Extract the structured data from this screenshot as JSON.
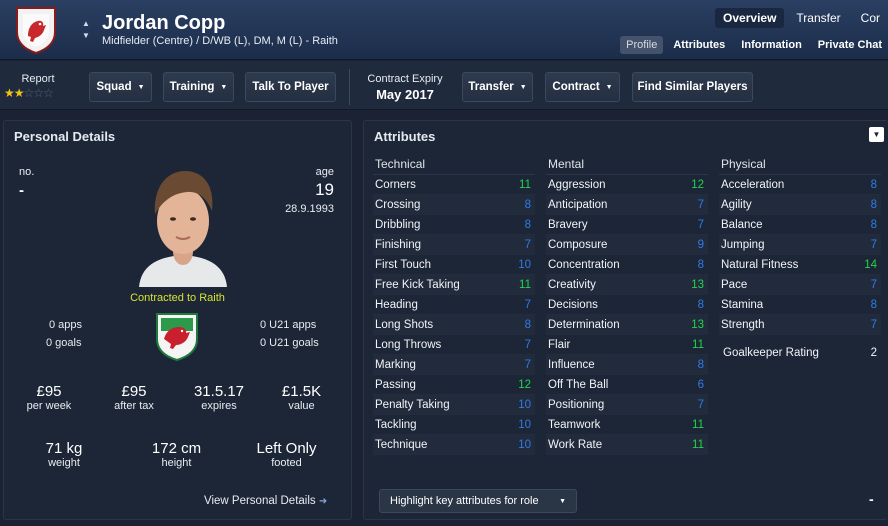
{
  "header": {
    "name": "Jordan Copp",
    "positions": "Midfielder (Centre) / D/WB (L), DM, M (L) - Raith",
    "tabs": [
      "Overview",
      "Transfer",
      "Cor"
    ],
    "subtabs": [
      "Profile",
      "Attributes",
      "Information",
      "Private Chat"
    ],
    "colors": {
      "header": "#2a3f62",
      "background": "#1a2233",
      "accent_green": "#22d44a",
      "accent_blue": "#2f7be8",
      "contract_yellow": "#d8e332"
    }
  },
  "toolbar": {
    "report_label": "Report",
    "report_stars": 2,
    "report_max_stars": 5,
    "squad": "Squad",
    "training": "Training",
    "talk": "Talk To Player",
    "expiry_label": "Contract Expiry",
    "expiry_value": "May 2017",
    "transfer": "Transfer",
    "contract": "Contract",
    "find_similar": "Find Similar Players"
  },
  "personal": {
    "title": "Personal Details",
    "no_label": "no.",
    "no_value": "-",
    "age_label": "age",
    "age_value": "19",
    "dob": "28.9.1993",
    "contracted": "Contracted to Raith",
    "apps": "0 apps",
    "goals": "0 goals",
    "u21_apps": "0 U21 apps",
    "u21_goals": "0 U21 goals",
    "wage": "£95",
    "wage_label": "per week",
    "after_tax": "£95",
    "after_tax_label": "after tax",
    "expires": "31.5.17",
    "expires_label": "expires",
    "value": "£1.5K",
    "value_label": "value",
    "weight": "71 kg",
    "weight_label": "weight",
    "height": "172 cm",
    "height_label": "height",
    "foot": "Left Only",
    "foot_label": "footed",
    "view_details": "View Personal Details"
  },
  "attributes": {
    "title": "Attributes",
    "technical": {
      "label": "Technical",
      "items": [
        {
          "name": "Corners",
          "value": "11",
          "color": "#22d44a"
        },
        {
          "name": "Crossing",
          "value": "8",
          "color": "#2f7be8"
        },
        {
          "name": "Dribbling",
          "value": "8",
          "color": "#2f7be8"
        },
        {
          "name": "Finishing",
          "value": "7",
          "color": "#2f7be8"
        },
        {
          "name": "First Touch",
          "value": "10",
          "color": "#2f7be8"
        },
        {
          "name": "Free Kick Taking",
          "value": "11",
          "color": "#22d44a"
        },
        {
          "name": "Heading",
          "value": "7",
          "color": "#2f7be8"
        },
        {
          "name": "Long Shots",
          "value": "8",
          "color": "#2f7be8"
        },
        {
          "name": "Long Throws",
          "value": "7",
          "color": "#2f7be8"
        },
        {
          "name": "Marking",
          "value": "7",
          "color": "#2f7be8"
        },
        {
          "name": "Passing",
          "value": "12",
          "color": "#22d44a"
        },
        {
          "name": "Penalty Taking",
          "value": "10",
          "color": "#2f7be8"
        },
        {
          "name": "Tackling",
          "value": "10",
          "color": "#2f7be8"
        },
        {
          "name": "Technique",
          "value": "10",
          "color": "#2f7be8"
        }
      ]
    },
    "mental": {
      "label": "Mental",
      "items": [
        {
          "name": "Aggression",
          "value": "12",
          "color": "#22d44a"
        },
        {
          "name": "Anticipation",
          "value": "7",
          "color": "#2f7be8"
        },
        {
          "name": "Bravery",
          "value": "7",
          "color": "#2f7be8"
        },
        {
          "name": "Composure",
          "value": "9",
          "color": "#2f7be8"
        },
        {
          "name": "Concentration",
          "value": "8",
          "color": "#2f7be8"
        },
        {
          "name": "Creativity",
          "value": "13",
          "color": "#22d44a"
        },
        {
          "name": "Decisions",
          "value": "8",
          "color": "#2f7be8"
        },
        {
          "name": "Determination",
          "value": "13",
          "color": "#22d44a"
        },
        {
          "name": "Flair",
          "value": "11",
          "color": "#22d44a"
        },
        {
          "name": "Influence",
          "value": "8",
          "color": "#2f7be8"
        },
        {
          "name": "Off The Ball",
          "value": "6",
          "color": "#2f7be8"
        },
        {
          "name": "Positioning",
          "value": "7",
          "color": "#2f7be8"
        },
        {
          "name": "Teamwork",
          "value": "11",
          "color": "#22d44a"
        },
        {
          "name": "Work Rate",
          "value": "11",
          "color": "#22d44a"
        }
      ]
    },
    "physical": {
      "label": "Physical",
      "items": [
        {
          "name": "Acceleration",
          "value": "8",
          "color": "#2f7be8"
        },
        {
          "name": "Agility",
          "value": "8",
          "color": "#2f7be8"
        },
        {
          "name": "Balance",
          "value": "8",
          "color": "#2f7be8"
        },
        {
          "name": "Jumping",
          "value": "7",
          "color": "#2f7be8"
        },
        {
          "name": "Natural Fitness",
          "value": "14",
          "color": "#22d44a"
        },
        {
          "name": "Pace",
          "value": "7",
          "color": "#2f7be8"
        },
        {
          "name": "Stamina",
          "value": "8",
          "color": "#2f7be8"
        },
        {
          "name": "Strength",
          "value": "7",
          "color": "#2f7be8"
        }
      ]
    },
    "gk_label": "Goalkeeper Rating",
    "gk_value": "2",
    "highlight": "Highlight key attributes for role",
    "dash": "-"
  }
}
